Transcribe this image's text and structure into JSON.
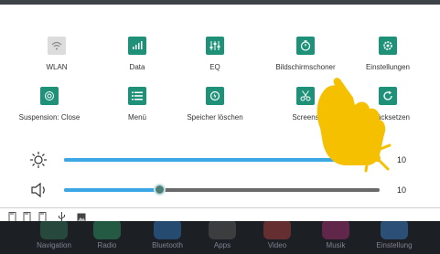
{
  "tiles": [
    {
      "label": "WLAN",
      "icon": "wifi-icon",
      "active": false
    },
    {
      "label": "Data",
      "icon": "data-bars-icon",
      "active": true
    },
    {
      "label": "EQ",
      "icon": "equalizer-icon",
      "active": true
    },
    {
      "label": "Bildschirmschoner",
      "icon": "screensaver-timer-icon",
      "active": true
    },
    {
      "label": "Einstellungen",
      "icon": "settings-gear-icon",
      "active": true
    },
    {
      "label": "Suspension: Close",
      "icon": "suspension-icon",
      "active": true
    },
    {
      "label": "Menü",
      "icon": "menu-list-icon",
      "active": true
    },
    {
      "label": "Speicher löschen",
      "icon": "clear-memory-icon",
      "active": true
    },
    {
      "label": "Screens",
      "icon": "screenshot-scissors-icon",
      "active": true
    },
    {
      "label": "Zurücksetzen",
      "icon": "reset-refresh-icon",
      "active": true
    }
  ],
  "sliders": {
    "brightness": {
      "value": "10",
      "level": 1.0,
      "icon": "brightness-sun-icon"
    },
    "volume": {
      "value": "10",
      "level": 0.3,
      "icon": "volume-speaker-icon"
    }
  },
  "dock": [
    {
      "label": "Navigation",
      "color": "#2f6a52"
    },
    {
      "label": "Radio",
      "color": "#2c8a5e"
    },
    {
      "label": "Bluetooth",
      "color": "#2f6fae"
    },
    {
      "label": "Apps",
      "color": "#555555"
    },
    {
      "label": "Video",
      "color": "#a33a3a"
    },
    {
      "label": "Musik",
      "color": "#9b2e6a"
    },
    {
      "label": "Einstellung",
      "color": "#3a78b8"
    }
  ],
  "colors": {
    "accent": "#1e9178",
    "slider_fill": "#3ba7e5",
    "hand": "#f5c000"
  }
}
